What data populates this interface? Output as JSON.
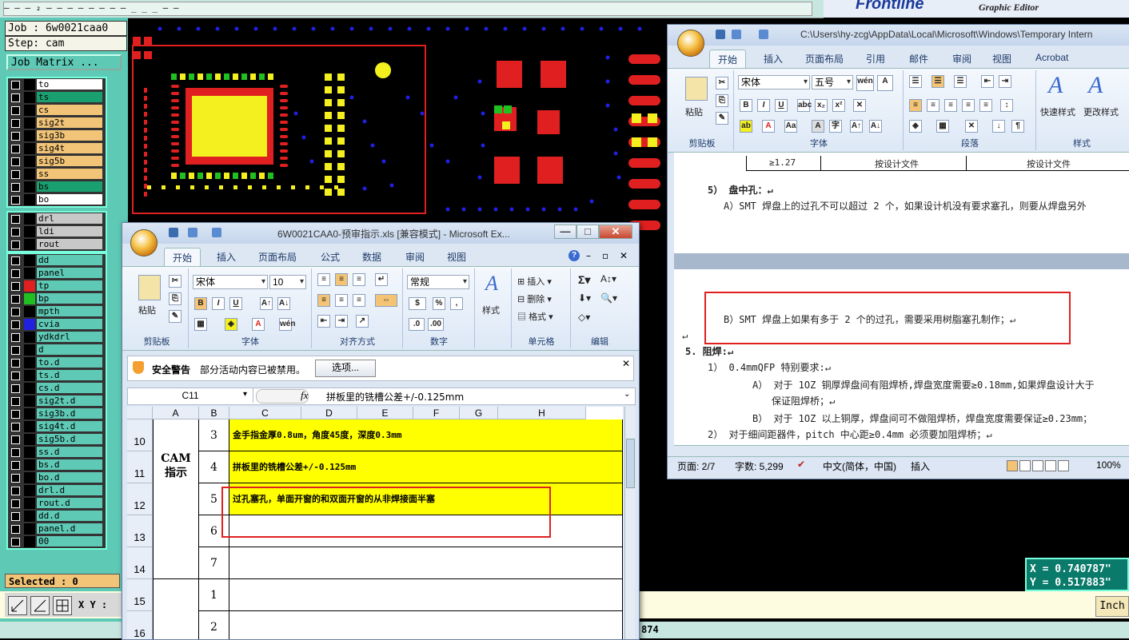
{
  "cam": {
    "top_menu_text": "— — — ₂ — — — — — — — — _  _ _ — —",
    "brand_logo": "Frontline",
    "brand_subtitle": "Graphic Editor",
    "job_label": "Job : 6w0021caa0",
    "step_label": "Step: cam",
    "job_matrix_button": "Job Matrix ...",
    "layer_groups": [
      [
        {
          "name": "to",
          "color": "#000000",
          "bg": "#ffffff"
        },
        {
          "name": "ts",
          "color": "#000000",
          "bg": "#1aa070"
        },
        {
          "name": "cs",
          "color": "#000000",
          "bg": "#f2c478"
        },
        {
          "name": "sig2t",
          "color": "#000000",
          "bg": "#f2c478"
        },
        {
          "name": "sig3b",
          "color": "#000000",
          "bg": "#f2c478"
        },
        {
          "name": "sig4t",
          "color": "#000000",
          "bg": "#f2c478"
        },
        {
          "name": "sig5b",
          "color": "#000000",
          "bg": "#f2c478"
        },
        {
          "name": "ss",
          "color": "#000000",
          "bg": "#f2c478"
        },
        {
          "name": "bs",
          "color": "#000000",
          "bg": "#1aa070"
        },
        {
          "name": "bo",
          "color": "#000000",
          "bg": "#ffffff"
        }
      ],
      [
        {
          "name": "drl",
          "color": "#000000",
          "bg": "#c8c8c8"
        },
        {
          "name": "ldi",
          "color": "#000000",
          "bg": "#c8c8c8"
        },
        {
          "name": "rout",
          "color": "#000000",
          "bg": "#c8c8c8"
        }
      ],
      [
        {
          "name": "dd",
          "color": "#000000",
          "bg": "#5ec9b5"
        },
        {
          "name": "panel",
          "color": "#000000",
          "bg": "#5ec9b5"
        },
        {
          "name": "tp",
          "color": "#e02020",
          "bg": "#5ec9b5"
        },
        {
          "name": "bp",
          "color": "#20c020",
          "bg": "#5ec9b5"
        },
        {
          "name": "mpth",
          "color": "#000000",
          "bg": "#5ec9b5"
        },
        {
          "name": "cvia",
          "color": "#2020e0",
          "bg": "#5ec9b5"
        },
        {
          "name": "ydkdrl",
          "color": "#000000",
          "bg": "#5ec9b5"
        },
        {
          "name": "d",
          "color": "#000000",
          "bg": "#5ec9b5"
        },
        {
          "name": "to.d",
          "color": "#000000",
          "bg": "#5ec9b5"
        },
        {
          "name": "ts.d",
          "color": "#000000",
          "bg": "#5ec9b5"
        },
        {
          "name": "cs.d",
          "color": "#000000",
          "bg": "#5ec9b5"
        },
        {
          "name": "sig2t.d",
          "color": "#000000",
          "bg": "#5ec9b5"
        },
        {
          "name": "sig3b.d",
          "color": "#000000",
          "bg": "#5ec9b5"
        },
        {
          "name": "sig4t.d",
          "color": "#000000",
          "bg": "#5ec9b5"
        },
        {
          "name": "sig5b.d",
          "color": "#000000",
          "bg": "#5ec9b5"
        },
        {
          "name": "ss.d",
          "color": "#000000",
          "bg": "#5ec9b5"
        },
        {
          "name": "bs.d",
          "color": "#000000",
          "bg": "#5ec9b5"
        },
        {
          "name": "bo.d",
          "color": "#000000",
          "bg": "#5ec9b5"
        },
        {
          "name": "drl.d",
          "color": "#000000",
          "bg": "#5ec9b5"
        },
        {
          "name": "rout.d",
          "color": "#000000",
          "bg": "#5ec9b5"
        },
        {
          "name": "dd.d",
          "color": "#000000",
          "bg": "#5ec9b5"
        },
        {
          "name": "panel.d",
          "color": "#000000",
          "bg": "#5ec9b5"
        },
        {
          "name": "00",
          "color": "#000000",
          "bg": "#5ec9b5"
        }
      ]
    ],
    "selected_label": "Selected : 0",
    "xy_label": "X Y :",
    "coord_x": "X = 0.740787\"",
    "coord_y": "Y = 0.517883\"",
    "units_button": "Inch",
    "bottom_number": "874"
  },
  "excel": {
    "title": "6W0021CAA0-预审指示.xls [兼容模式] - Microsoft Ex...",
    "tabs": [
      "开始",
      "插入",
      "页面布局",
      "公式",
      "数据",
      "审阅",
      "视图"
    ],
    "font_name": "宋体",
    "font_size": "10",
    "number_format": "常规",
    "paste_label": "粘贴",
    "style_label": "样式",
    "insert_label": "插入",
    "delete_label": "删除",
    "format_label": "格式",
    "group_labels": [
      "剪贴板",
      "字体",
      "对齐方式",
      "数字",
      "单元格",
      "编辑"
    ],
    "security_title": "安全警告",
    "security_text": "部分活动内容已被禁用。",
    "options_button": "选项...",
    "name_box": "C11",
    "formula": "拼板里的铣槽公差+/-0.125mm",
    "columns": [
      "A",
      "B",
      "C",
      "D",
      "E",
      "F",
      "G",
      "H"
    ],
    "row_numbers": [
      "10",
      "11",
      "12",
      "13",
      "14",
      "15",
      "16"
    ],
    "cam_label": "CAM\n指示",
    "rows": [
      {
        "num": "3",
        "text": "金手指金厚0.8um，角度45度，深度0.3mm"
      },
      {
        "num": "4",
        "text": "拼板里的铣槽公差+/-0.125mm"
      },
      {
        "num": "5",
        "text": "过孔塞孔，单面开窗的和双面开窗的从非焊接面半塞"
      },
      {
        "num": "6",
        "text": ""
      },
      {
        "num": "7",
        "text": ""
      },
      {
        "num": "1",
        "text": ""
      },
      {
        "num": "2",
        "text": ""
      }
    ]
  },
  "word": {
    "title": "C:\\Users\\hy-zcg\\AppData\\Local\\Microsoft\\Windows\\Temporary Intern",
    "tabs": [
      "开始",
      "插入",
      "页面布局",
      "引用",
      "邮件",
      "审阅",
      "视图",
      "Acrobat"
    ],
    "font_name": "宋体",
    "font_size": "五号",
    "paste_label": "粘贴",
    "quick_style": "快速样式",
    "change_style": "更改样式",
    "group_labels": [
      "剪贴板",
      "字体",
      "段落",
      "样式"
    ],
    "table_row": [
      "≥1.27",
      "按设计文件",
      "按设计文件"
    ],
    "lines": [
      "5） 盘中孔：↵",
      "A）SMT 焊盘上的过孔不可以超过 2 个，如果设计机没有要求塞孔，则要从焊盘另外",
      "B）SMT 焊盘上如果有多于 2 个的过孔，需要采用树脂塞孔制作；↵",
      "↵",
      "5.  阻焊:↵",
      "1） 0.4mmQFP 特别要求:↵",
      "A） 对于 1OZ 铜厚焊盘间有阻焊桥,焊盘宽度需要≥0.18mm,如果焊盘设计大于",
      "保证阻焊桥；↵",
      "B） 对于 1OZ 以上铜厚，焊盘间可不做阻焊桥，焊盘宽度需要保证≥0.23mm；",
      "2） 对于细间距器件，pitch 中心距≥0.4mm 必须要加阻焊桥；↵"
    ],
    "status_page": "页面: 2/7",
    "status_words": "字数: 5,299",
    "status_lang": "中文(简体，中国)",
    "status_insert": "插入",
    "status_zoom": "100%"
  }
}
